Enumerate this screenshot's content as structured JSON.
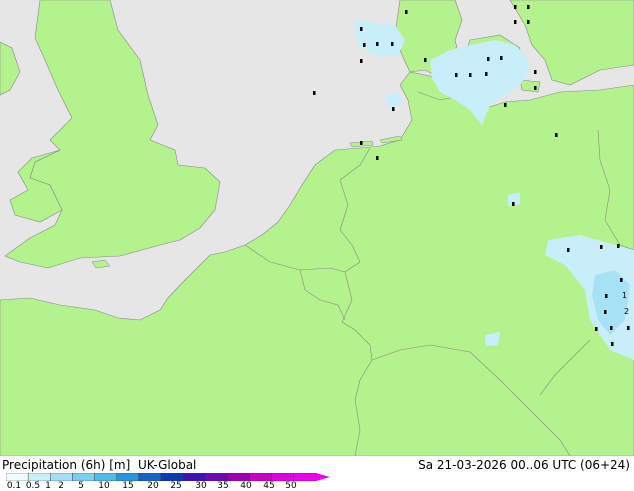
{
  "map": {
    "colors": {
      "sea": "#e6e6e6",
      "land": "#b3f28c",
      "border": "#888888",
      "precip_light": "#c8eefa",
      "precip_mid": "#a6e2f5"
    }
  },
  "footer": {
    "title_parts": [
      "Precipitation (6h) [m]",
      "UK-Global"
    ],
    "valid_time": "Sa 21-03-2026 00..06 UTC (06+24)"
  },
  "legend": {
    "labels": [
      "0.1",
      "0.5",
      "1",
      "2",
      "5",
      "10",
      "15",
      "20",
      "25",
      "30",
      "35",
      "40",
      "45",
      "50"
    ],
    "colors": [
      "#f0fcff",
      "#c8eefa",
      "#a0e0f5",
      "#78d0ee",
      "#50bce6",
      "#2896dc",
      "#1464c8",
      "#0a3cb4",
      "#3c14b4",
      "#6e0ab4",
      "#a000b4",
      "#c800c8",
      "#e000e0",
      "#f000f0"
    ]
  }
}
